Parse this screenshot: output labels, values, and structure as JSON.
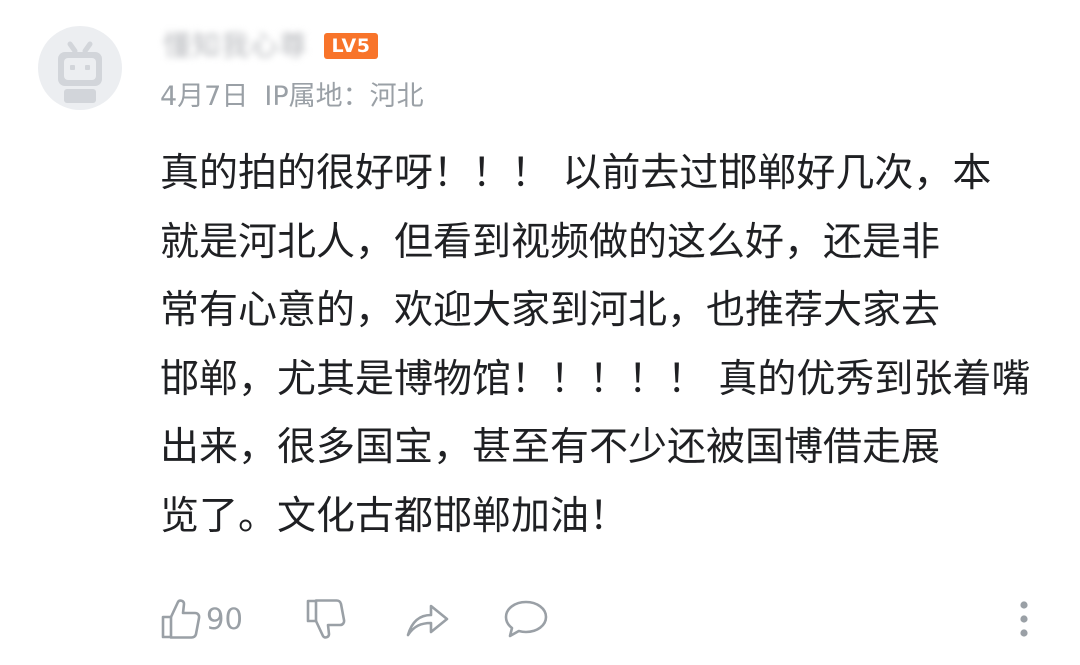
{
  "comment": {
    "username": "懂知我心尊",
    "level_badge": "LV5",
    "date": "4月7日",
    "ip_location": "IP属地：河北",
    "text_lines": [
      "真的拍的很好呀！！！ 以前去过邯郸好几次，本",
      "就是河北人，但看到视频做的这么好，还是非",
      "常有心意的，欢迎大家到河北，也推荐大家去",
      "邯郸，尤其是博物馆！！！！！ 真的优秀到张着嘴",
      "出来，很多国宝，甚至有不少还被国博借走展",
      "览了。文化古都邯郸加油！"
    ],
    "like_count": "90"
  },
  "colors": {
    "badge": "#f8742a",
    "meta_text": "#9aa0a6",
    "icon": "#9aa0a6",
    "body_text": "#1f2023",
    "avatar_bg": "#eceef1",
    "avatar_icon": "#d2d5da"
  },
  "icons": {
    "avatar": "bilibili-tv-icon",
    "like": "thumbs-up-icon",
    "dislike": "thumbs-down-icon",
    "share": "share-arrow-icon",
    "reply": "speech-bubble-icon",
    "more": "vertical-ellipsis-icon"
  }
}
